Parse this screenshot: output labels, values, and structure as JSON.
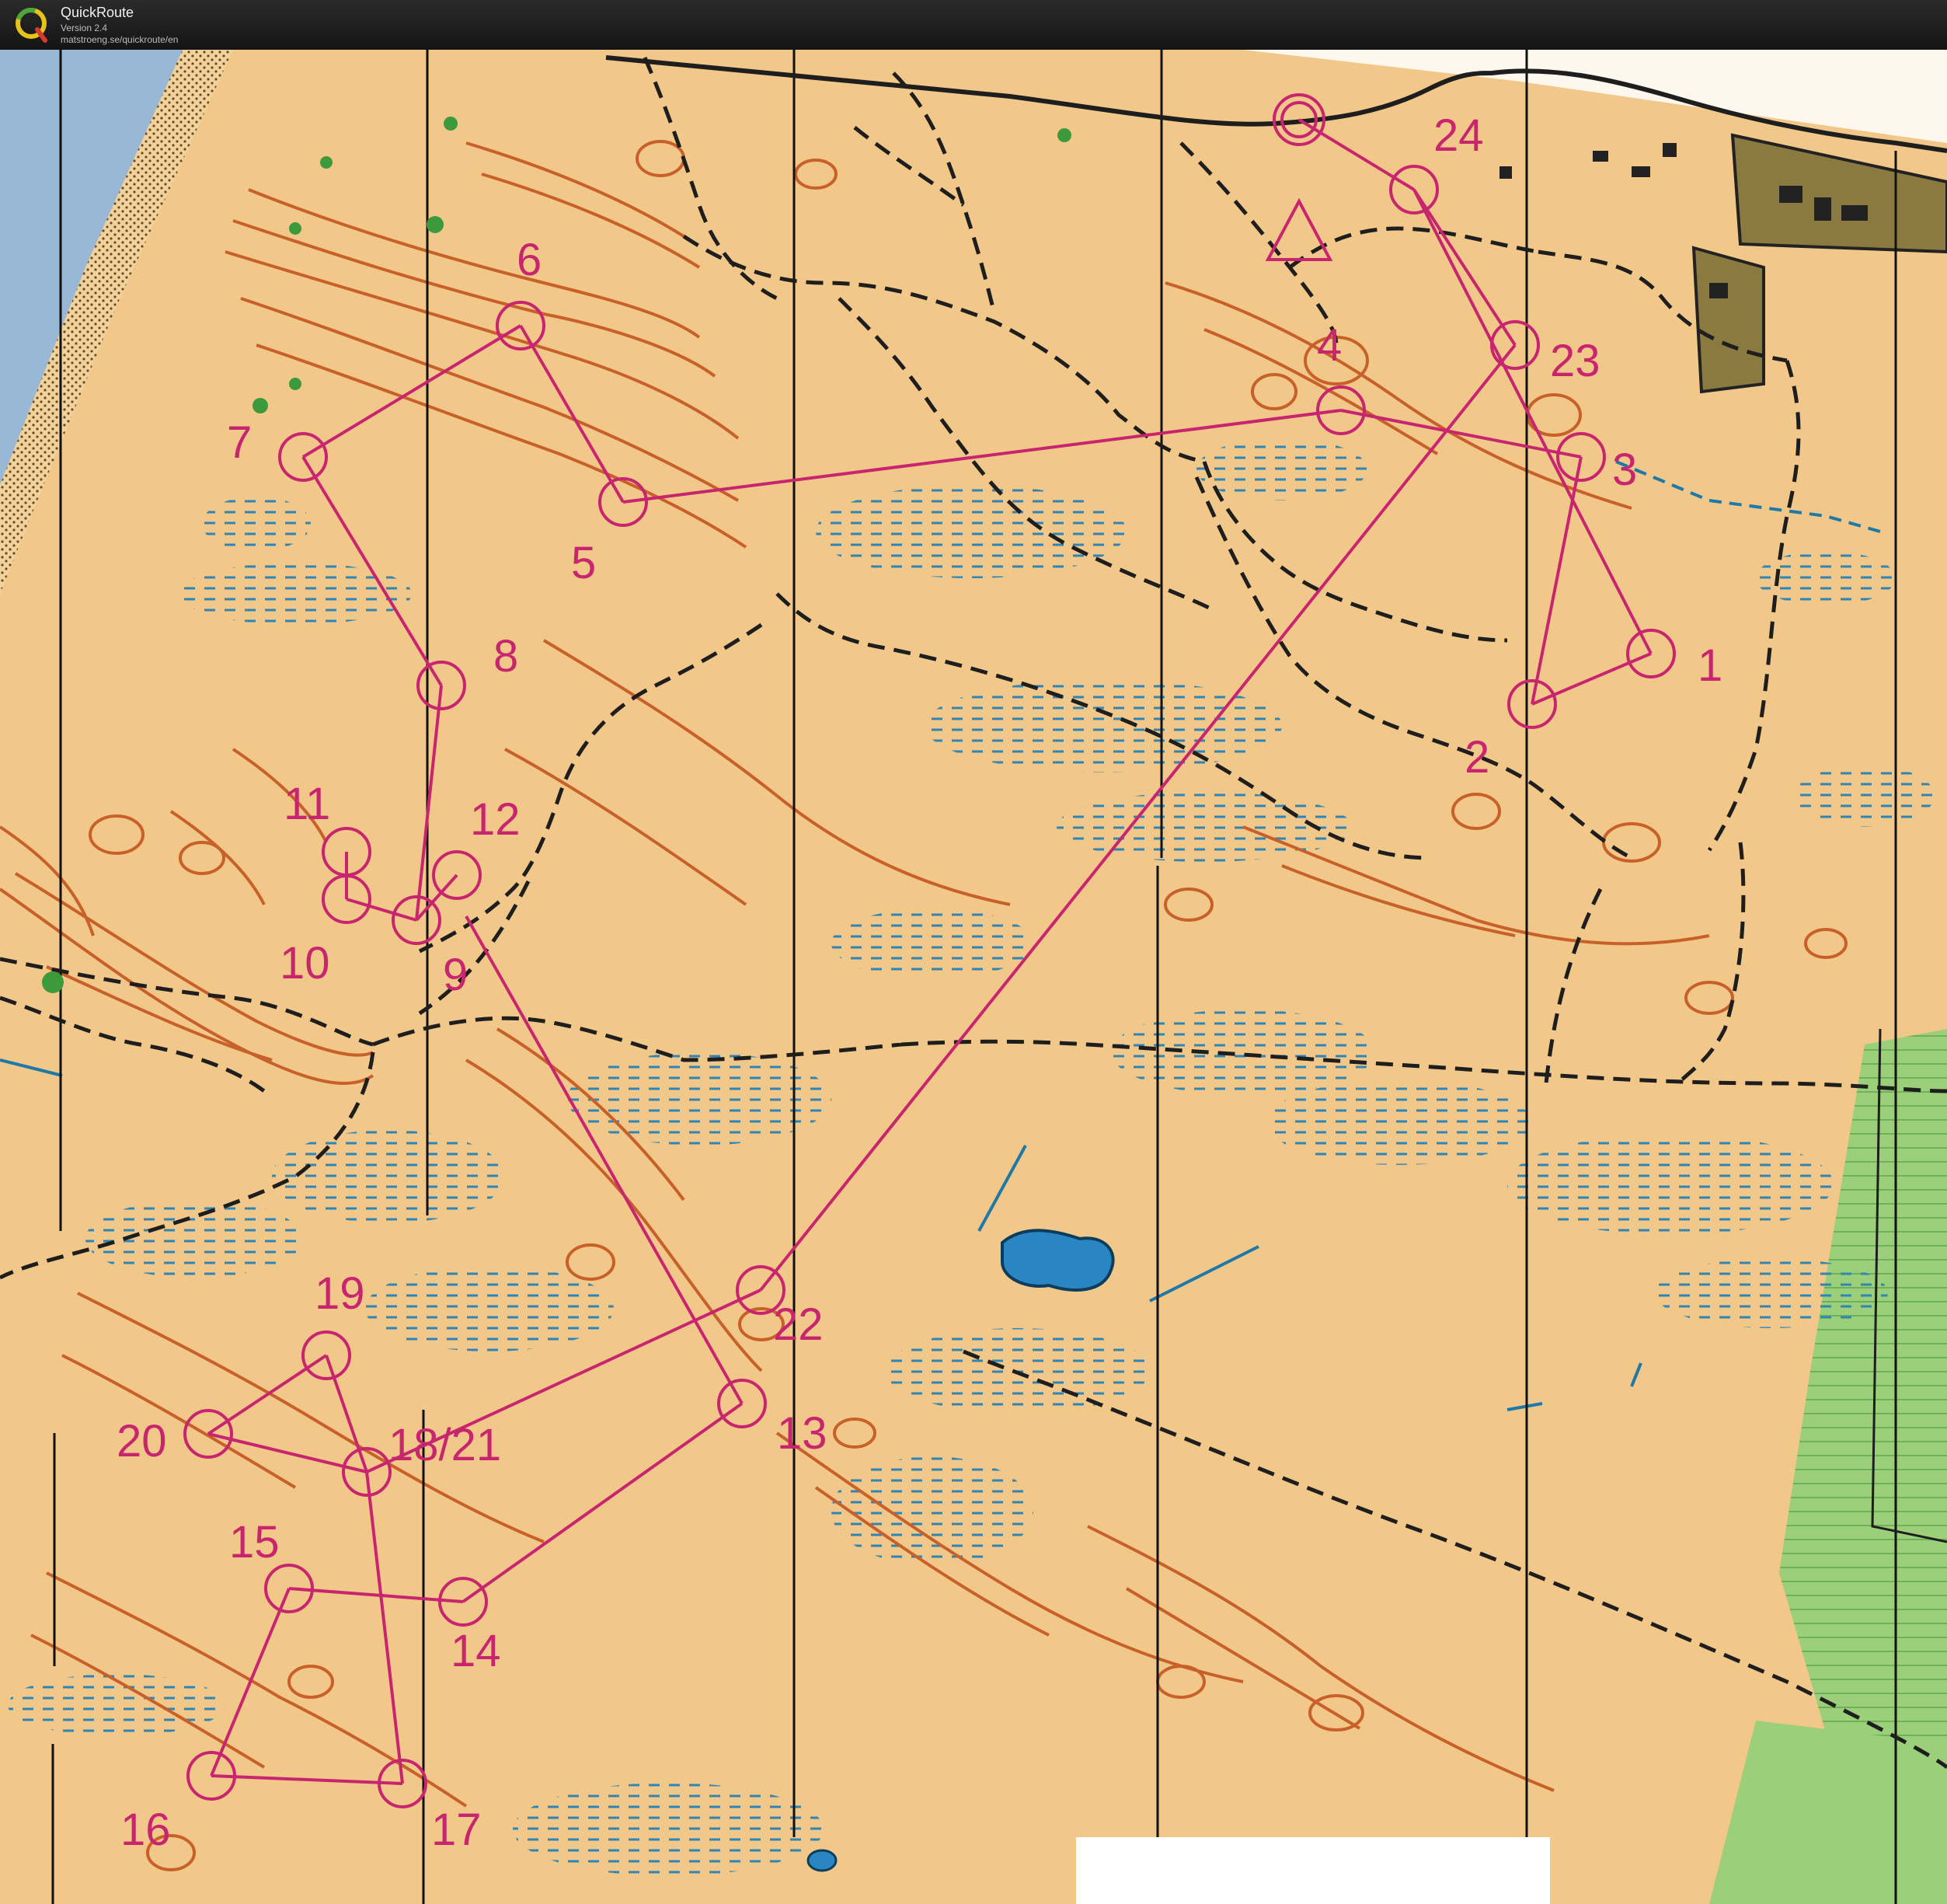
{
  "app": {
    "name": "QuickRoute",
    "version": "Version 2.4",
    "url": "matstroeng.se/quickroute/en"
  },
  "map": {
    "icon": "quickroute-logo-icon",
    "colors": {
      "terrain": "#f2c88a",
      "contour": "#c8602a",
      "water": "#1e78a8",
      "course": "#c8256f",
      "track": "#1e1e1e",
      "vegetation": "#8cc46a",
      "settlement": "#8a7a40",
      "lake": "#2a86c2"
    },
    "controls": [
      {
        "label": "1"
      },
      {
        "label": "2"
      },
      {
        "label": "3"
      },
      {
        "label": "4"
      },
      {
        "label": "5"
      },
      {
        "label": "6"
      },
      {
        "label": "7"
      },
      {
        "label": "8"
      },
      {
        "label": "9"
      },
      {
        "label": "10"
      },
      {
        "label": "11"
      },
      {
        "label": "12"
      },
      {
        "label": "13"
      },
      {
        "label": "14"
      },
      {
        "label": "15"
      },
      {
        "label": "16"
      },
      {
        "label": "17"
      },
      {
        "label": "18/21"
      },
      {
        "label": "19"
      },
      {
        "label": "20"
      },
      {
        "label": "22"
      },
      {
        "label": "23"
      },
      {
        "label": "24"
      }
    ]
  }
}
